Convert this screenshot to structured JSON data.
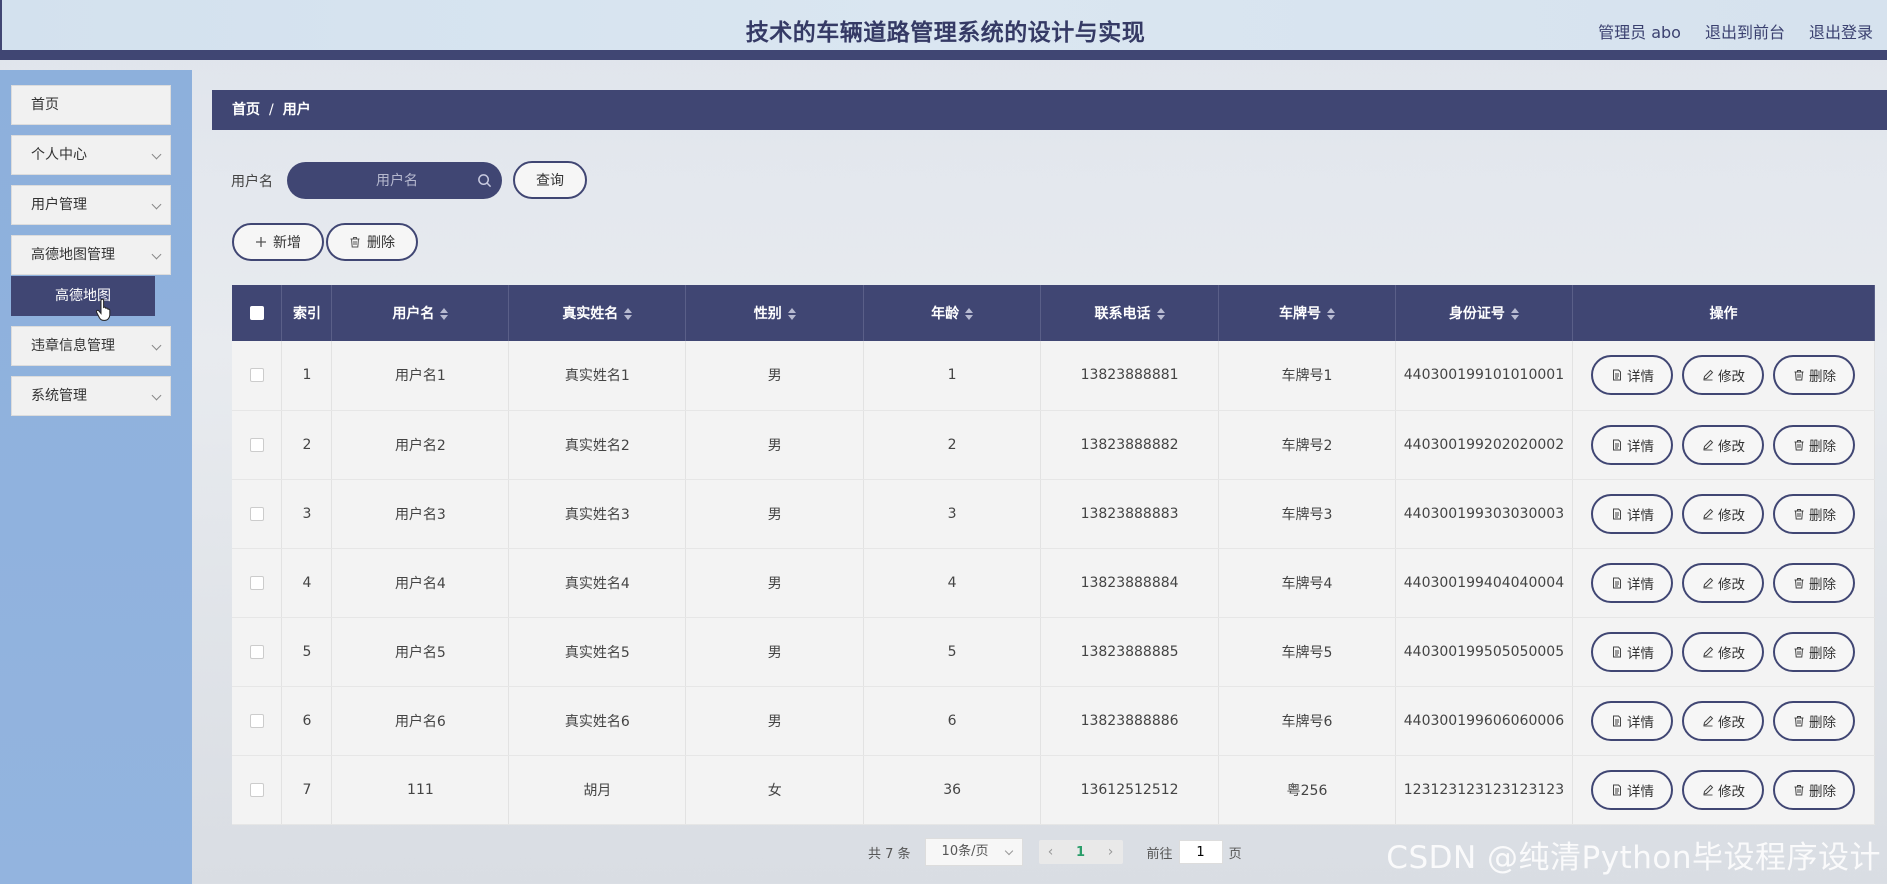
{
  "header": {
    "title": "技术的车辆道路管理系统的设计与实现",
    "user": "管理员 abo",
    "to_front": "退出到前台",
    "logout": "退出登录"
  },
  "sidebar": {
    "items": [
      {
        "label": "首页",
        "has_arrow": false
      },
      {
        "label": "个人中心",
        "has_arrow": true
      },
      {
        "label": "用户管理",
        "has_arrow": true
      },
      {
        "label": "高德地图管理",
        "has_arrow": true
      },
      {
        "label": "违章信息管理",
        "has_arrow": true
      },
      {
        "label": "系统管理",
        "has_arrow": true
      }
    ],
    "submenu": {
      "label": "高德地图"
    }
  },
  "breadcrumb": {
    "home": "首页",
    "sep": "/",
    "current": "用户"
  },
  "search": {
    "label": "用户名",
    "placeholder": "用户名",
    "button": "查询"
  },
  "actions": {
    "add": "新增",
    "delete": "删除"
  },
  "table": {
    "headers": [
      "索引",
      "用户名",
      "真实姓名",
      "性别",
      "年龄",
      "联系电话",
      "车牌号",
      "身份证号",
      "操作"
    ],
    "rows": [
      [
        "1",
        "用户名1",
        "真实姓名1",
        "男",
        "1",
        "13823888881",
        "车牌号1",
        "440300199101010001"
      ],
      [
        "2",
        "用户名2",
        "真实姓名2",
        "男",
        "2",
        "13823888882",
        "车牌号2",
        "440300199202020002"
      ],
      [
        "3",
        "用户名3",
        "真实姓名3",
        "男",
        "3",
        "13823888883",
        "车牌号3",
        "440300199303030003"
      ],
      [
        "4",
        "用户名4",
        "真实姓名4",
        "男",
        "4",
        "13823888884",
        "车牌号4",
        "440300199404040004"
      ],
      [
        "5",
        "用户名5",
        "真实姓名5",
        "男",
        "5",
        "13823888885",
        "车牌号5",
        "440300199505050005"
      ],
      [
        "6",
        "用户名6",
        "真实姓名6",
        "男",
        "6",
        "13823888886",
        "车牌号6",
        "440300199606060006"
      ],
      [
        "7",
        "111",
        "胡月",
        "女",
        "36",
        "13612512512",
        "粤256",
        "123123123123123123"
      ]
    ],
    "row_actions": {
      "detail": "详情",
      "edit": "修改",
      "delete": "删除"
    }
  },
  "pagination": {
    "total": "共 7 条",
    "page_size": "10条/页",
    "current_page": "1",
    "goto_prefix": "前往",
    "goto_value": "1",
    "goto_suffix": "页"
  },
  "watermark": "CSDN @纯清Python毕设程序设计",
  "colors": {
    "accent": "#404673",
    "sidebar": "#8db0dc",
    "page_active": "#2a9d6a"
  }
}
